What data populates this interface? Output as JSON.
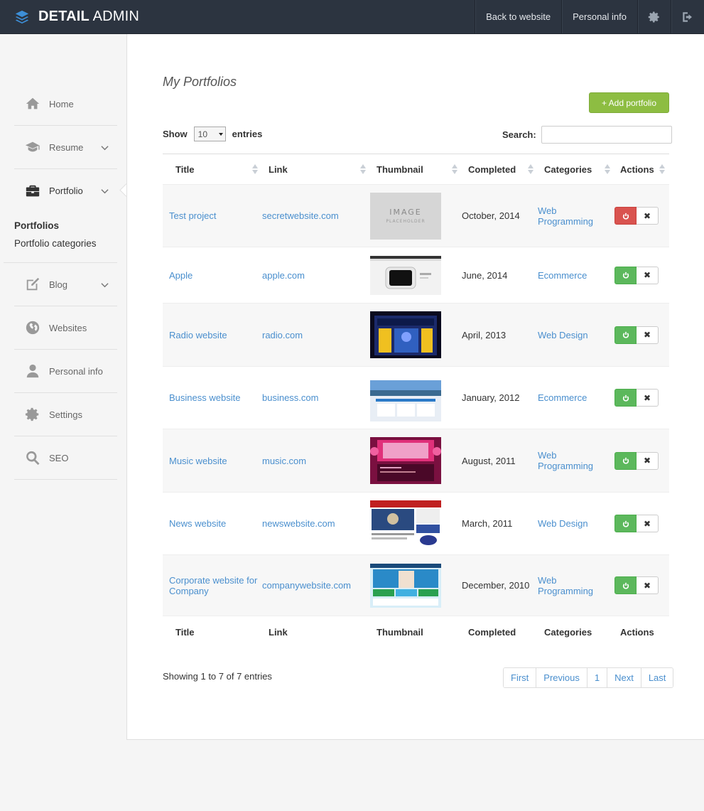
{
  "header": {
    "brand_bold": "DETAIL",
    "brand_light": "ADMIN",
    "links": [
      "Back to website",
      "Personal info"
    ],
    "icons": [
      "gear-icon",
      "sign-out-icon"
    ]
  },
  "sidebar": {
    "items": [
      {
        "label": "Home",
        "icon": "home-icon"
      },
      {
        "label": "Resume",
        "icon": "graduation-cap-icon"
      },
      {
        "label": "Portfolio",
        "icon": "briefcase-icon"
      },
      {
        "label": "Blog",
        "icon": "edit-icon"
      },
      {
        "label": "Websites",
        "icon": "globe-icon"
      },
      {
        "label": "Personal info",
        "icon": "user-icon"
      },
      {
        "label": "Settings",
        "icon": "gear-icon"
      },
      {
        "label": "SEO",
        "icon": "search-icon"
      }
    ],
    "subitems": [
      "Portfolios",
      "Portfolio categories"
    ]
  },
  "main": {
    "title": "My Portfolios",
    "add_button": "+ Add portfolio",
    "show_label": "Show",
    "entries_label": "entries",
    "page_length": "10",
    "search_label": "Search:",
    "search_value": "",
    "columns": [
      "Title",
      "Link",
      "Thumbnail",
      "Completed",
      "Categories",
      "Actions"
    ],
    "rows": [
      {
        "title": "Test project",
        "link": "secretwebsite.com",
        "completed": "October, 2014",
        "category": "Web Programming",
        "active": false
      },
      {
        "title": "Apple",
        "link": "apple.com",
        "completed": "June, 2014",
        "category": "Ecommerce",
        "active": true
      },
      {
        "title": "Radio website",
        "link": "radio.com",
        "completed": "April, 2013",
        "category": "Web Design",
        "active": true
      },
      {
        "title": "Business website",
        "link": "business.com",
        "completed": "January, 2012",
        "category": "Ecommerce",
        "active": true
      },
      {
        "title": "Music website",
        "link": "music.com",
        "completed": "August, 2011",
        "category": "Web Programming",
        "active": true
      },
      {
        "title": "News website",
        "link": "newswebsite.com",
        "completed": "March, 2011",
        "category": "Web Design",
        "active": true
      },
      {
        "title": "Corporate website for Company",
        "link": "companywebsite.com",
        "completed": "December, 2010",
        "category": "Web Programming",
        "active": true
      }
    ],
    "info": "Showing 1 to 7 of 7 entries",
    "pagination": [
      "First",
      "Previous",
      "1",
      "Next",
      "Last"
    ],
    "delete_glyph": "✖",
    "placeholder_thumb_text": "IMAGE",
    "placeholder_thumb_sub": "PLACEHOLDER"
  },
  "colors": {
    "topbar": "#2c3440",
    "link": "#4a8fce",
    "green": "#5cb85c",
    "red": "#d9534f",
    "add": "#8dbd42"
  }
}
